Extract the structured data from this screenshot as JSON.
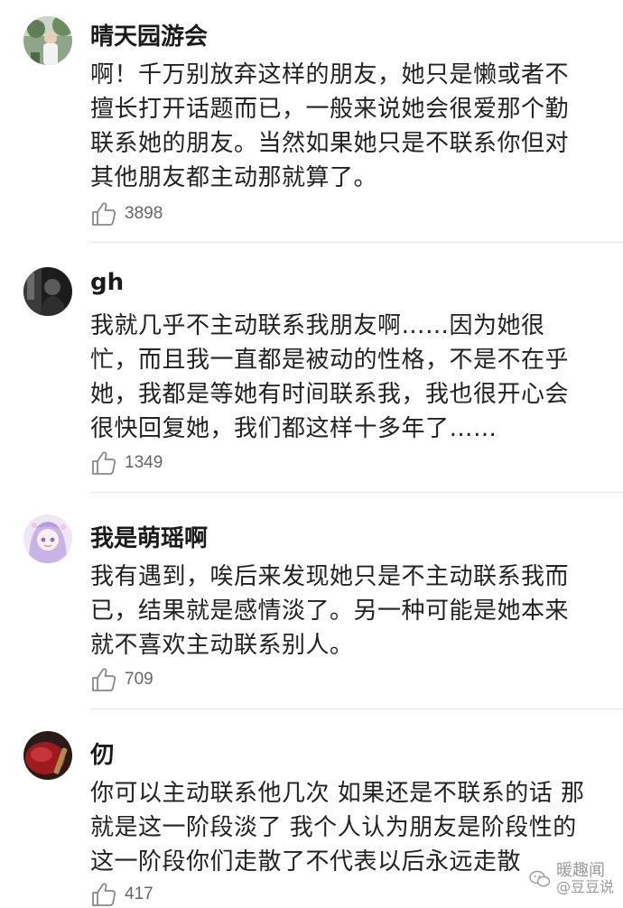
{
  "comments": [
    {
      "username": "晴天园游会",
      "lines": [
        "啊！千万别放弃这样的朋友，她只是懒或者不",
        "擅长打开话题而已，一般来说她会很爱那个勤",
        "联系她的朋友。当然如果她只是不联系你但对",
        "其他朋友都主动那就算了。"
      ],
      "likes": "3898",
      "avatar_icon": "avatar-photo-person-outdoor"
    },
    {
      "username": "gh",
      "lines": [
        "我就几乎不主动联系我朋友啊……因为她很",
        "忙，而且我一直都是被动的性格，不是不在乎",
        "她，我都是等她有时间联系我，我也很开心会",
        "很快回复她，我们都这样十多年了……"
      ],
      "likes": "1349",
      "avatar_icon": "avatar-photo-dark-figure"
    },
    {
      "username": "我是萌瑶啊",
      "lines": [
        "我有遇到，唉后来发现她只是不主动联系我而",
        "已，结果就是感情淡了。另一种可能是她本来",
        "就不喜欢主动联系别人。"
      ],
      "likes": "709",
      "avatar_icon": "avatar-anime-girl-lilac"
    },
    {
      "username": "仞",
      "lines": [
        "你可以主动联系他几次 如果还是不联系的话 那",
        "就是这一阶段淡了 我个人认为朋友是阶段性的",
        "这一阶段你们走散了不代表以后永远走散"
      ],
      "likes": "417",
      "avatar_icon": "avatar-red-object"
    }
  ],
  "watermark": {
    "line1": "暖趣闻",
    "line2": "@豆豆说",
    "icon": "wechat-icon"
  },
  "colors": {
    "text": "#222222",
    "username": "#1a1a1a",
    "like_count": "#666666",
    "divider": "#e6e6e6"
  }
}
